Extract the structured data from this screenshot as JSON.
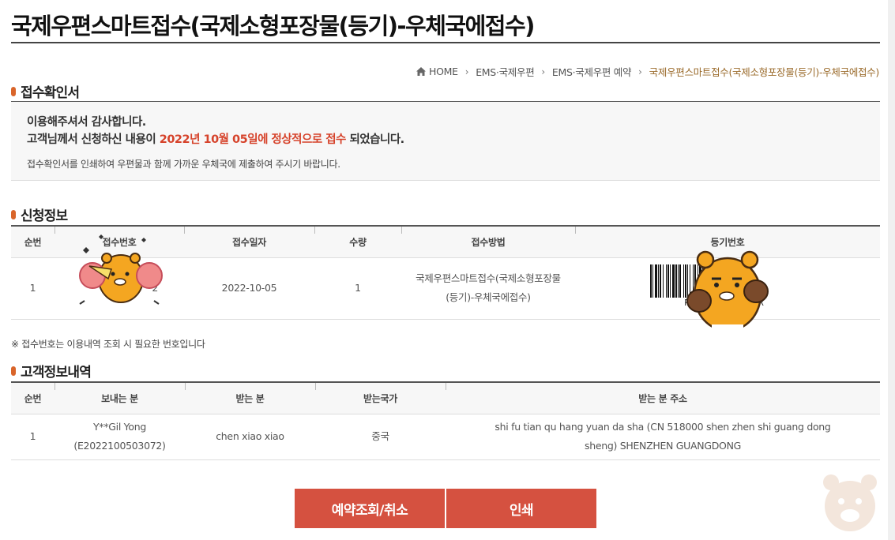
{
  "page": {
    "title": "국제우편스마트접수(국제소형포장물(등기)-우체국에접수)"
  },
  "breadcrumb": {
    "home": "HOME",
    "items": [
      "EMS·국제우편",
      "EMS·국제우편 예약"
    ],
    "current": "국제우편스마트접수(국제소형포장물(등기)-우체국에접수)",
    "separator": "›"
  },
  "confirmation": {
    "heading": "접수확인서",
    "thanks": "이용해주셔서 감사합니다.",
    "status_prefix": "고객님께서 신청하신 내용이",
    "status_highlight": "2022년 10월 05일에 정상적으로 접수",
    "status_suffix": "되었습니다.",
    "instruction": "접수확인서를 인쇄하여 우편물과 함께 가까운 우체국에 제출하여 주시기 바랍니다."
  },
  "application": {
    "heading": "신청정보",
    "columns": [
      "순번",
      "접수번호",
      "접수일자",
      "수량",
      "접수방법",
      "등기번호"
    ],
    "row": {
      "seq": "1",
      "receipt_no_visible": "2",
      "date": "2022-10-05",
      "qty": "1",
      "method_line1": "국제우편스마트접수(국제소형포장물",
      "method_line2": "(등기)-우체국에접수)",
      "barcode_text": "R S            K R"
    },
    "note": "※ 접수번호는 이용내역 조회 시 필요한 번호입니다"
  },
  "customer": {
    "heading": "고객정보내역",
    "columns": [
      "순번",
      "보내는 분",
      "받는 분",
      "받는국가",
      "받는 분 주소"
    ],
    "row": {
      "seq": "1",
      "sender_name": "Y**Gil Yong",
      "sender_id": "(E2022100503072)",
      "recipient": "chen xiao xiao",
      "country": "중국",
      "address_line1": "shi fu tian qu hang yuan da sha  (CN 518000 shen zhen shi guang dong",
      "address_line2": "sheng)    SHENZHEN    GUANGDONG"
    }
  },
  "buttons": {
    "cancel": "예약조회/취소",
    "print": "인쇄"
  },
  "colors": {
    "accent": "#d55140",
    "highlight": "#d6432b",
    "bullet": "#d9652a",
    "breadcrumb_current": "#9a6a2a"
  }
}
